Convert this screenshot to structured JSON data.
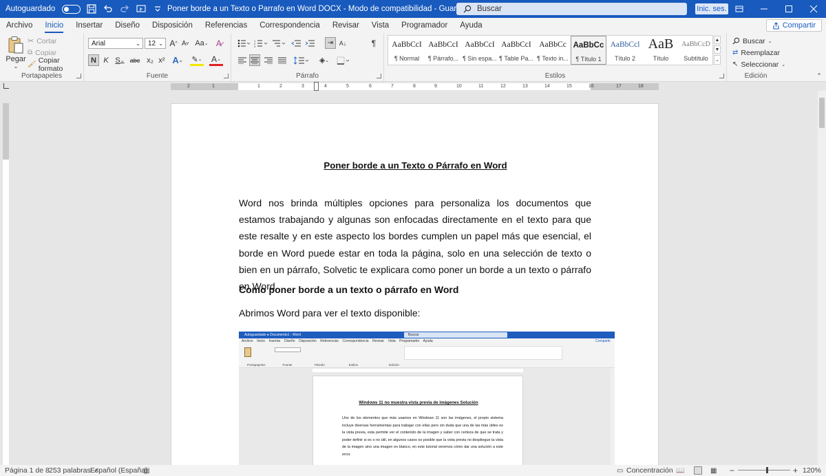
{
  "titlebar": {
    "autosave_label": "Autoguardado",
    "document_title": "Poner borde a un Texto o Parrafo en Word DOCX  -  Modo de compatibilidad  -  Guardado en Este PC",
    "search_placeholder": "Buscar",
    "signin_label": "Inic. ses.",
    "accent_color": "#185abd"
  },
  "menu": {
    "tabs": [
      "Archivo",
      "Inicio",
      "Insertar",
      "Diseño",
      "Disposición",
      "Referencias",
      "Correspondencia",
      "Revisar",
      "Vista",
      "Programador",
      "Ayuda"
    ],
    "active_tab": "Inicio",
    "share_label": "Compartir"
  },
  "ribbon": {
    "clipboard": {
      "paste_label": "Pegar",
      "cut_label": "Cortar",
      "copy_label": "Copiar",
      "format_painter_label": "Copiar formato",
      "group_label": "Portapapeles"
    },
    "font": {
      "font_name": "Arial",
      "font_size": "12",
      "bold": "N",
      "italic": "K",
      "underline": "S",
      "strike": "abc",
      "subscript": "x₂",
      "superscript": "x²",
      "grow": "A",
      "shrink": "A",
      "case": "Aa",
      "group_label": "Fuente"
    },
    "paragraph": {
      "group_label": "Párrafo"
    },
    "styles": {
      "items": [
        {
          "sample": "AaBbCcI",
          "name": "¶ Normal"
        },
        {
          "sample": "AaBbCcI",
          "name": "¶ Párrafo..."
        },
        {
          "sample": "AaBbCcI",
          "name": "¶ Sin espa..."
        },
        {
          "sample": "AaBbCcI",
          "name": "¶ Table Pa..."
        },
        {
          "sample": "AaBbCc",
          "name": "¶ Texto in..."
        },
        {
          "sample": "AaBbCc",
          "name": "¶ Título 1"
        },
        {
          "sample": "AaBbCcl",
          "name": "Título 2"
        },
        {
          "sample": "AaB",
          "name": "Título"
        },
        {
          "sample": "AaBbCcD",
          "name": "Subtítulo"
        }
      ],
      "group_label": "Estilos"
    },
    "editing": {
      "find_label": "Buscar",
      "replace_label": "Reemplazar",
      "select_label": "Seleccionar",
      "group_label": "Edición"
    }
  },
  "ruler": {
    "numbers": [
      "2",
      "1",
      "1",
      "2",
      "3",
      "4",
      "5",
      "6",
      "7",
      "8",
      "9",
      "10",
      "11",
      "12",
      "13",
      "14",
      "15",
      "16",
      "17",
      "18"
    ]
  },
  "document": {
    "heading": "Poner borde a un Texto o Párrafo en Word",
    "paragraph": "Word nos brinda múltiples opciones para personaliza los documentos que estamos trabajando y algunas son enfocadas directamente en el texto para que este resalte y en este aspecto los bordes cumplen un papel más que esencial, el borde en Word puede estar en toda la página, solo en una selección de texto o bien en un párrafo, Solvetic te explicara como poner un borde a un texto o párrafo en Word.",
    "subheading": "Como poner borde a un texto o párrafo en Word",
    "line": "Abrimos Word para ver el texto disponible:"
  },
  "embedded": {
    "title": "Autoguardado  ●  Documento1 - Word",
    "search": "Buscar",
    "tabs": "Archivo    Inicio    Insertar    Diseño    Disposición    Referencias    Correspondencia    Revisar    Vista    Programador    Ayuda",
    "share": "Compartir",
    "ribbon_labels": "Portapapeles                    Fuente                          Párrafo                            Estilos                                    Edición",
    "heading": "Windows 11 no muestra vista previa de imágenes  Solución",
    "body": "Uno de los elementos que más usamos en Windows 11 son las imágenes, el propio sistema incluye diversas herramientas para trabajar con ellas pero sin duda que una de las más útiles es la vista previa, esta permite ver el contenido de la imagen y saber con certeza de que se trata y poder definir si es o no útil, en algunos casos es posible que la vista previa no despliegue la vista de la imagen sino una imagen en blanco, en este tutorial veremos cómo dar una solución a este error."
  },
  "statusbar": {
    "page": "Página 1 de 8",
    "words": "253 palabras",
    "language": "Español (España)",
    "focus": "Concentración",
    "zoom": "120%"
  }
}
